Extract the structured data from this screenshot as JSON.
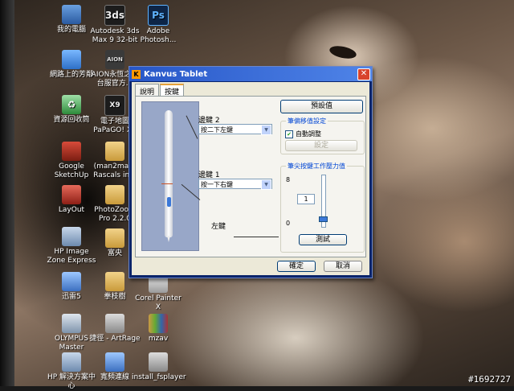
{
  "desktop": {
    "icons": [
      {
        "label": "我的電腦",
        "glyph": "",
        "icon": "computer-icon"
      },
      {
        "label": "Autodesk 3ds Max 9 32-bit",
        "glyph": "3ds",
        "icon": "autodesk-icon"
      },
      {
        "label": "Adobe Photosh...",
        "glyph": "Ps",
        "icon": "photoshop-icon"
      },
      {
        "label": "網路上的芳鄰",
        "glyph": "",
        "icon": "network-icon"
      },
      {
        "label": "AION永恆之塔 台服官方...",
        "glyph": "AION",
        "icon": "aion-icon"
      },
      {
        "label": "資源回收筒",
        "glyph": "♻",
        "icon": "recycle-bin-icon"
      },
      {
        "label": "電子地圖 PaPaGO! X9",
        "glyph": "X9",
        "icon": "papago-icon"
      },
      {
        "label": "Google SketchUp",
        "glyph": "",
        "icon": "sketchup-icon"
      },
      {
        "label": "(man2man) Rascals in 2",
        "glyph": "",
        "icon": "folder-icon"
      },
      {
        "label": "LayOut",
        "glyph": "",
        "icon": "layout-icon"
      },
      {
        "label": "PhotoZoom Pro 2.2.0",
        "glyph": "",
        "icon": "folder-icon"
      },
      {
        "label": "HP Image Zone Express",
        "glyph": "",
        "icon": "hp-icon"
      },
      {
        "label": "富央",
        "glyph": "",
        "icon": "folder-icon"
      },
      {
        "label": "迅雷5",
        "glyph": "",
        "icon": "thunder-icon"
      },
      {
        "label": "拳枝樹",
        "glyph": "",
        "icon": "folder-icon"
      },
      {
        "label": "Corel Painter X",
        "glyph": "",
        "icon": "corel-icon"
      },
      {
        "label": "OLYMPUS Master",
        "glyph": "",
        "icon": "olympus-icon"
      },
      {
        "label": "捷徑 - ArtRage",
        "glyph": "",
        "icon": "artrage-icon"
      },
      {
        "label": "mzav",
        "glyph": "",
        "icon": "winrar-icon"
      },
      {
        "label": "HP 解決方案中心",
        "glyph": "",
        "icon": "hp-icon"
      },
      {
        "label": "寬頻連線",
        "glyph": "",
        "icon": "broadband-icon"
      },
      {
        "label": "install_fsplayer",
        "glyph": "",
        "icon": "installer-icon"
      }
    ]
  },
  "dialog": {
    "title": "Kanvus Tablet",
    "title_icon": "K",
    "close": "✕",
    "tabs": [
      {
        "label": "說明",
        "active": false
      },
      {
        "label": "按鍵",
        "active": true
      }
    ],
    "side_button_2": {
      "label": "邊鍵 2",
      "value": "按二下左鍵"
    },
    "side_button_1": {
      "label": "邊鍵 1",
      "value": "按一下右鍵"
    },
    "tip": {
      "label": "左鍵"
    },
    "default_button": "預設值",
    "pen_move_group": {
      "title": "筆偏移值設定",
      "auto_adjust_label": "自動調整",
      "auto_adjust_checked": true,
      "setup_button": "設定"
    },
    "pressure_group": {
      "title": "筆尖按鍵工作壓力值",
      "max": "8",
      "min": "0",
      "value": "1",
      "test_button": "測試"
    },
    "ok_button": "確定",
    "cancel_button": "取消"
  },
  "watermark": "#1692727",
  "colors": {
    "titlebar": "#2756c7",
    "dialog_bg": "#ece9d8",
    "pen_panel": "#98a7c8"
  }
}
